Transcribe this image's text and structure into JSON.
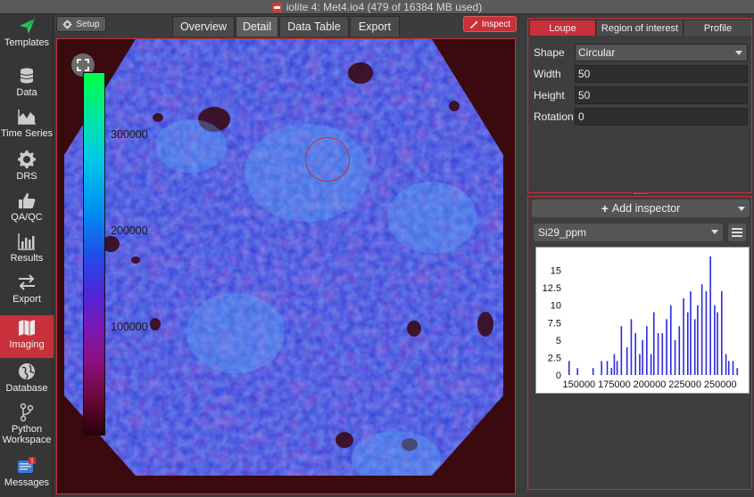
{
  "window": {
    "title": "iolite 4: Met4.io4 (479 of 16384 MB used)"
  },
  "sidebar": {
    "items": [
      {
        "label": "Templates",
        "icon": "templates-icon"
      },
      {
        "label": "Data",
        "icon": "database-icon"
      },
      {
        "label": "Time Series",
        "icon": "time-series-icon"
      },
      {
        "label": "DRS",
        "icon": "gear-icon"
      },
      {
        "label": "QA/QC",
        "icon": "thumbs-up-icon"
      },
      {
        "label": "Results",
        "icon": "bar-chart-icon"
      },
      {
        "label": "Export",
        "icon": "export-arrows-icon"
      },
      {
        "label": "Imaging",
        "icon": "map-icon"
      },
      {
        "label": "Database",
        "icon": "globe-icon"
      },
      {
        "label": "Python\nWorkspace",
        "icon": "python-branch-icon"
      },
      {
        "label": "Messages",
        "icon": "messages-icon",
        "badge": "1"
      }
    ],
    "active": "Imaging",
    "colors": {
      "active": "#c8303a",
      "templates_icon": "#2ec45a"
    }
  },
  "toolbar": {
    "setup_label": "Setup",
    "inspect_label": "Inspect",
    "tabs": [
      "Overview",
      "Detail",
      "Data Table",
      "Export"
    ],
    "active_tab": "Detail"
  },
  "image_view": {
    "colorbar_labels": [
      "300000",
      "200000",
      "100000"
    ],
    "loupe_overlay": "circular"
  },
  "right_panel": {
    "tabs": [
      "Loupe",
      "Region of interest",
      "Profile"
    ],
    "active_tab": "Loupe",
    "properties": {
      "shape_label": "Shape",
      "shape_value": "Circular",
      "width_label": "Width",
      "width_value": "50",
      "height_label": "Height",
      "height_value": "50",
      "rotation_label": "Rotation",
      "rotation_value": "0"
    },
    "add_inspector_label": "Add inspector",
    "channel": "Si29_ppm",
    "histogram": {
      "y_ticks": [
        "15",
        "12.5",
        "10",
        "7.5",
        "5",
        "2.5",
        "0"
      ],
      "x_ticks": [
        "150000",
        "175000",
        "200000",
        "225000",
        "250000"
      ]
    }
  },
  "chart_data": {
    "type": "bar",
    "title": "",
    "xlabel": "",
    "ylabel": "",
    "ylim": [
      0,
      17.5
    ],
    "xlim": [
      140000,
      265000
    ],
    "x": [
      143000,
      149000,
      160000,
      166000,
      170000,
      173000,
      175000,
      177000,
      180000,
      184000,
      187000,
      190000,
      193000,
      195000,
      198000,
      201000,
      203000,
      206000,
      209000,
      212000,
      215000,
      218000,
      221000,
      224000,
      227000,
      229000,
      232000,
      234000,
      237000,
      240000,
      243000,
      246000,
      248000,
      251000,
      254000,
      256000,
      259000,
      262000
    ],
    "values": [
      2,
      1,
      1,
      2,
      2,
      1,
      3,
      2,
      7,
      4,
      8,
      6,
      3,
      5,
      7,
      3,
      9,
      6,
      6,
      8,
      10,
      5,
      7,
      11,
      9,
      12,
      8,
      10,
      13,
      12,
      17,
      10,
      9,
      12,
      3,
      2,
      2,
      1
    ]
  }
}
